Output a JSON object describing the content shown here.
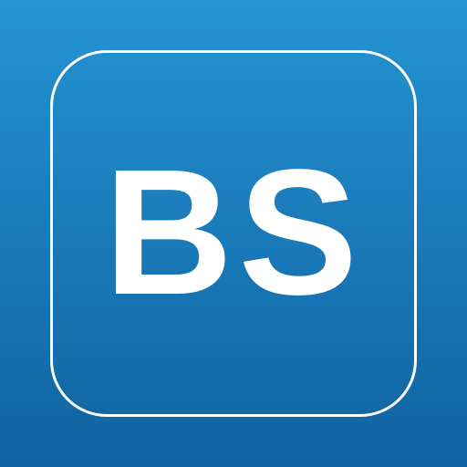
{
  "icon": {
    "monogram": "BS",
    "colors": {
      "gradient_top": "#2494d3",
      "gradient_bottom": "#0f63a0",
      "foreground": "#ffffff"
    }
  }
}
